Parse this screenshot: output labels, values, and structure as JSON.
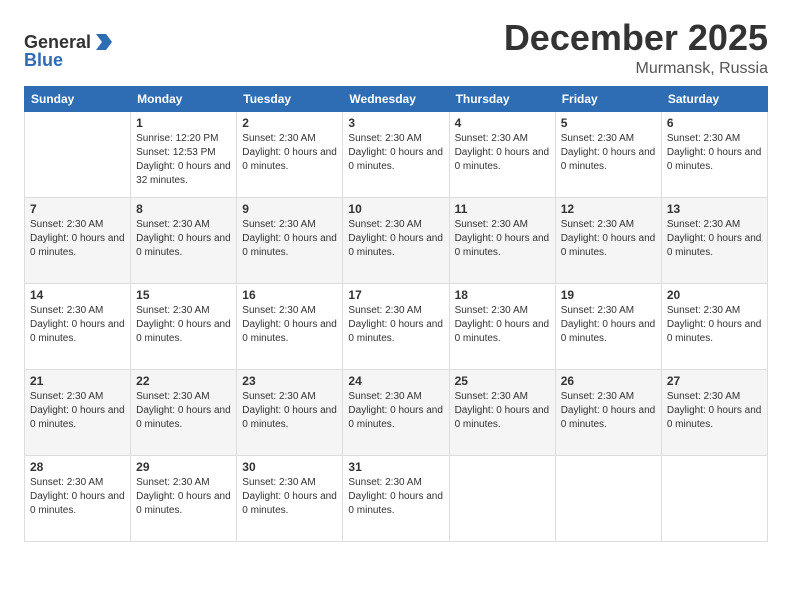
{
  "header": {
    "logo_general": "General",
    "logo_blue": "Blue",
    "month_title": "December 2025",
    "location": "Murmansk, Russia"
  },
  "weekdays": [
    "Sunday",
    "Monday",
    "Tuesday",
    "Wednesday",
    "Thursday",
    "Friday",
    "Saturday"
  ],
  "weeks": [
    [
      {
        "day": "",
        "info": ""
      },
      {
        "day": "1",
        "info": "Sunrise: 12:20 PM\nSunset: 12:53 PM\nDaylight: 0 hours\nand 32 minutes."
      },
      {
        "day": "2",
        "info": "Sunset: 2:30 AM\nDaylight: 0 hours\nand 0 minutes."
      },
      {
        "day": "3",
        "info": "Sunset: 2:30 AM\nDaylight: 0 hours\nand 0 minutes."
      },
      {
        "day": "4",
        "info": "Sunset: 2:30 AM\nDaylight: 0 hours\nand 0 minutes."
      },
      {
        "day": "5",
        "info": "Sunset: 2:30 AM\nDaylight: 0 hours\nand 0 minutes."
      },
      {
        "day": "6",
        "info": "Sunset: 2:30 AM\nDaylight: 0 hours\nand 0 minutes."
      }
    ],
    [
      {
        "day": "7",
        "info": "Sunset: 2:30 AM\nDaylight: 0 hours\nand 0 minutes."
      },
      {
        "day": "8",
        "info": "Sunset: 2:30 AM\nDaylight: 0 hours\nand 0 minutes."
      },
      {
        "day": "9",
        "info": "Sunset: 2:30 AM\nDaylight: 0 hours\nand 0 minutes."
      },
      {
        "day": "10",
        "info": "Sunset: 2:30 AM\nDaylight: 0 hours\nand 0 minutes."
      },
      {
        "day": "11",
        "info": "Sunset: 2:30 AM\nDaylight: 0 hours\nand 0 minutes."
      },
      {
        "day": "12",
        "info": "Sunset: 2:30 AM\nDaylight: 0 hours\nand 0 minutes."
      },
      {
        "day": "13",
        "info": "Sunset: 2:30 AM\nDaylight: 0 hours\nand 0 minutes."
      }
    ],
    [
      {
        "day": "14",
        "info": "Sunset: 2:30 AM\nDaylight: 0 hours\nand 0 minutes."
      },
      {
        "day": "15",
        "info": "Sunset: 2:30 AM\nDaylight: 0 hours\nand 0 minutes."
      },
      {
        "day": "16",
        "info": "Sunset: 2:30 AM\nDaylight: 0 hours\nand 0 minutes."
      },
      {
        "day": "17",
        "info": "Sunset: 2:30 AM\nDaylight: 0 hours\nand 0 minutes."
      },
      {
        "day": "18",
        "info": "Sunset: 2:30 AM\nDaylight: 0 hours\nand 0 minutes."
      },
      {
        "day": "19",
        "info": "Sunset: 2:30 AM\nDaylight: 0 hours\nand 0 minutes."
      },
      {
        "day": "20",
        "info": "Sunset: 2:30 AM\nDaylight: 0 hours\nand 0 minutes."
      }
    ],
    [
      {
        "day": "21",
        "info": "Sunset: 2:30 AM\nDaylight: 0 hours\nand 0 minutes."
      },
      {
        "day": "22",
        "info": "Sunset: 2:30 AM\nDaylight: 0 hours\nand 0 minutes."
      },
      {
        "day": "23",
        "info": "Sunset: 2:30 AM\nDaylight: 0 hours\nand 0 minutes."
      },
      {
        "day": "24",
        "info": "Sunset: 2:30 AM\nDaylight: 0 hours\nand 0 minutes."
      },
      {
        "day": "25",
        "info": "Sunset: 2:30 AM\nDaylight: 0 hours\nand 0 minutes."
      },
      {
        "day": "26",
        "info": "Sunset: 2:30 AM\nDaylight: 0 hours\nand 0 minutes."
      },
      {
        "day": "27",
        "info": "Sunset: 2:30 AM\nDaylight: 0 hours\nand 0 minutes."
      }
    ],
    [
      {
        "day": "28",
        "info": "Sunset: 2:30 AM\nDaylight: 0 hours\nand 0 minutes."
      },
      {
        "day": "29",
        "info": "Sunset: 2:30 AM\nDaylight: 0 hours\nand 0 minutes."
      },
      {
        "day": "30",
        "info": "Sunset: 2:30 AM\nDaylight: 0 hours\nand 0 minutes."
      },
      {
        "day": "31",
        "info": "Sunset: 2:30 AM\nDaylight: 0 hours\nand 0 minutes."
      },
      {
        "day": "",
        "info": ""
      },
      {
        "day": "",
        "info": ""
      },
      {
        "day": "",
        "info": ""
      }
    ]
  ],
  "alt_rows": [
    1,
    3
  ],
  "colors": {
    "header_bg": "#2e6db4",
    "header_text": "#ffffff",
    "alt_row_bg": "#f5f5f5"
  }
}
